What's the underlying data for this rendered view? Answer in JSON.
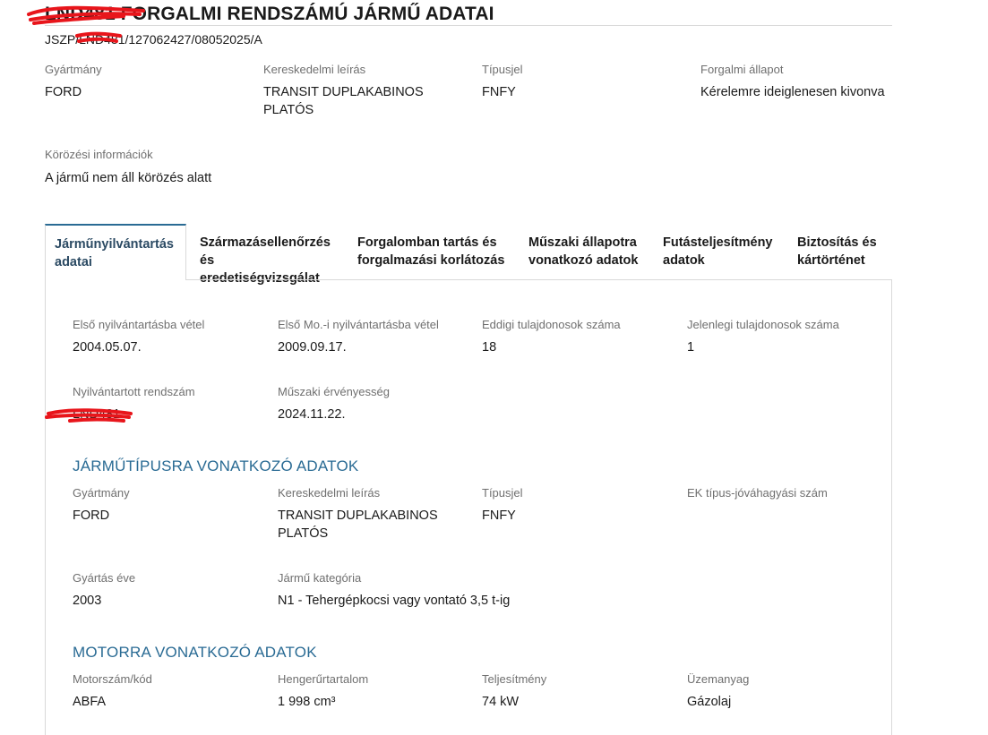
{
  "header": {
    "title": "LND481 FORGALMI RENDSZÁMÚ JÁRMŰ ADATAI",
    "reference": "JSZP/LND481/127062427/08052025/A"
  },
  "summary": {
    "manufacturer_label": "Gyártmány",
    "manufacturer_value": "FORD",
    "trade_label": "Kereskedelmi leírás",
    "trade_value_line1": "TRANSIT DUPLAKABINOS",
    "trade_value_line2": "PLATÓS",
    "type_label": "Típusjel",
    "type_value": "FNFY",
    "status_label": "Forgalmi állapot",
    "status_value": "Kérelemre ideiglenesen kivonva",
    "wanted_label": "Körözési információk",
    "wanted_value": "A jármű nem áll körözés alatt"
  },
  "tabs": [
    {
      "line1": "Járműnyilvántartás",
      "line2": "adatai"
    },
    {
      "line1": "Származásellenőrzés",
      "line2": "és eredetiségvizsgálat"
    },
    {
      "line1": "Forgalomban tartás és",
      "line2": "forgalmazási korlátozás"
    },
    {
      "line1": "Műszaki állapotra",
      "line2": "vonatkozó adatok"
    },
    {
      "line1": "Futásteljesítmény",
      "line2": "adatok"
    },
    {
      "line1": "Biztosítás és",
      "line2": "kártörténet"
    }
  ],
  "registration": {
    "first_reg_label": "Első nyilvántartásba vétel",
    "first_reg_value": "2004.05.07.",
    "first_hu_reg_label": "Első Mo.-i nyilvántartásba vétel",
    "first_hu_reg_value": "2009.09.17.",
    "owners_label": "Eddigi tulajdonosok száma",
    "owners_value": "18",
    "current_owners_label": "Jelenlegi tulajdonosok száma",
    "current_owners_value": "1",
    "plate_label": "Nyilvántartott rendszám",
    "plate_value": "LND481",
    "inspection_label": "Műszaki érvényesség",
    "inspection_value": "2024.11.22."
  },
  "vehicle_type": {
    "title": "JÁRMŰTÍPUSRA VONATKOZÓ ADATOK",
    "manufacturer_label": "Gyártmány",
    "manufacturer_value": "FORD",
    "trade_label": "Kereskedelmi leírás",
    "trade_value_line1": "TRANSIT DUPLAKABINOS",
    "trade_value_line2": "PLATÓS",
    "type_label": "Típusjel",
    "type_value": "FNFY",
    "ec_label": "EK típus-jóváhagyási szám",
    "ec_value": "",
    "year_label": "Gyártás éve",
    "year_value": "2003",
    "category_label": "Jármű kategória",
    "category_value": "N1 - Tehergépkocsi vagy vontató 3,5 t-ig"
  },
  "engine": {
    "title": "MOTORRA VONATKOZÓ ADATOK",
    "code_label": "Motorszám/kód",
    "code_value": "ABFA",
    "displacement_label": "Hengerűrtartalom",
    "displacement_value": "1 998 cm³",
    "power_label": "Teljesítmény",
    "power_value": "74 kW",
    "fuel_label": "Üzemanyag",
    "fuel_value": "Gázolaj"
  },
  "colors": {
    "accent": "#2a6b94",
    "redaction": "#e8151b"
  }
}
